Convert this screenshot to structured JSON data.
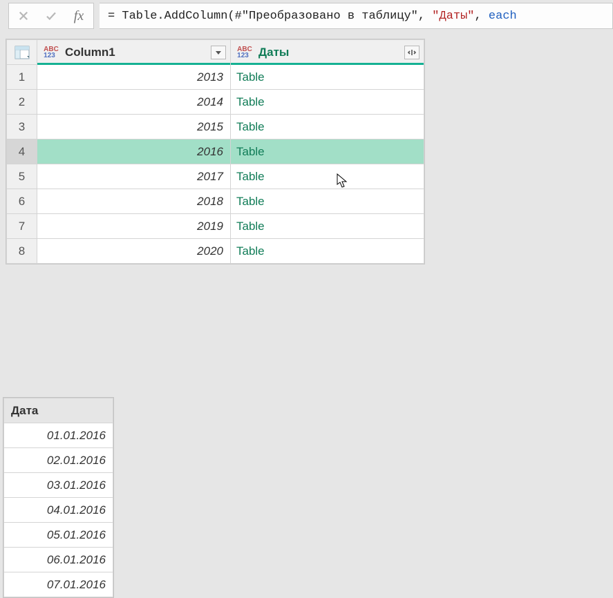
{
  "formula": {
    "prefix": "= ",
    "fn_open": "Table.AddColumn(",
    "step_ref": "#\"Преобразовано в таблицу\"",
    "sep1": ", ",
    "str_arg": "\"Даты\"",
    "sep2": ", ",
    "kw_tail": "each"
  },
  "columns": [
    {
      "name": "Column1",
      "new": false
    },
    {
      "name": "Даты",
      "new": true
    }
  ],
  "type_icon_top": "ABC",
  "type_icon_bot": "123",
  "rows": [
    {
      "n": "1",
      "c1": "2013",
      "c2": "Table",
      "selected": false
    },
    {
      "n": "2",
      "c1": "2014",
      "c2": "Table",
      "selected": false
    },
    {
      "n": "3",
      "c1": "2015",
      "c2": "Table",
      "selected": false
    },
    {
      "n": "4",
      "c1": "2016",
      "c2": "Table",
      "selected": true
    },
    {
      "n": "5",
      "c1": "2017",
      "c2": "Table",
      "selected": false
    },
    {
      "n": "6",
      "c1": "2018",
      "c2": "Table",
      "selected": false
    },
    {
      "n": "7",
      "c1": "2019",
      "c2": "Table",
      "selected": false
    },
    {
      "n": "8",
      "c1": "2020",
      "c2": "Table",
      "selected": false
    }
  ],
  "preview": {
    "header": "Дата",
    "rows": [
      "01.01.2016",
      "02.01.2016",
      "03.01.2016",
      "04.01.2016",
      "05.01.2016",
      "06.01.2016",
      "07.01.2016"
    ]
  }
}
